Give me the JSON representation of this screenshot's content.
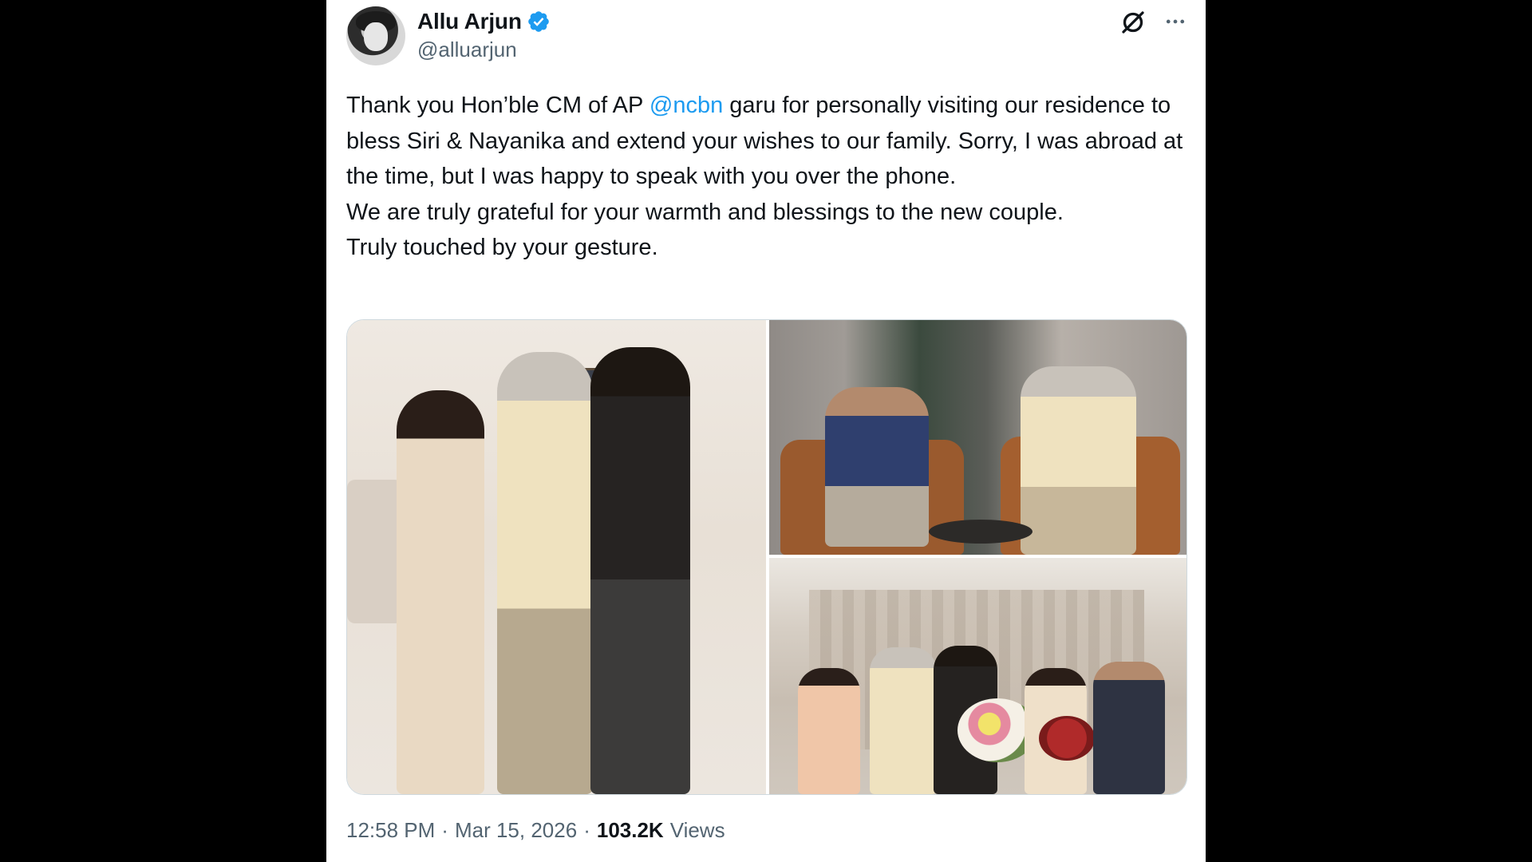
{
  "author": {
    "display_name": "Allu Arjun",
    "handle": "@alluarjun",
    "verified_icon": "verified-badge-icon",
    "avatar_icon": "avatar"
  },
  "tweet": {
    "text_before_mention": "Thank you Hon’ble CM of AP ",
    "mention": "@ncbn",
    "text_after_mention": " garu for personally visiting our residence to bless Siri & Nayanika and extend your wishes to our family. Sorry, I was abroad at the time, but I was happy to speak with you over the phone.",
    "line_2": "We are truly grateful for your warmth and blessings to the new couple.",
    "line_3": "Truly touched by your gesture."
  },
  "meta": {
    "time": "12:58 PM",
    "separator_1": "·",
    "date": "Mar 15, 2026",
    "separator_2": "·",
    "views_count": "103.2K",
    "views_label": "Views"
  },
  "icons": {
    "grok": "grok-icon",
    "more": "more-icon"
  },
  "colors": {
    "accent": "#1d9bf0",
    "text": "#0f1419",
    "secondary_text": "#536471",
    "background": "#000000",
    "card": "#ffffff"
  }
}
